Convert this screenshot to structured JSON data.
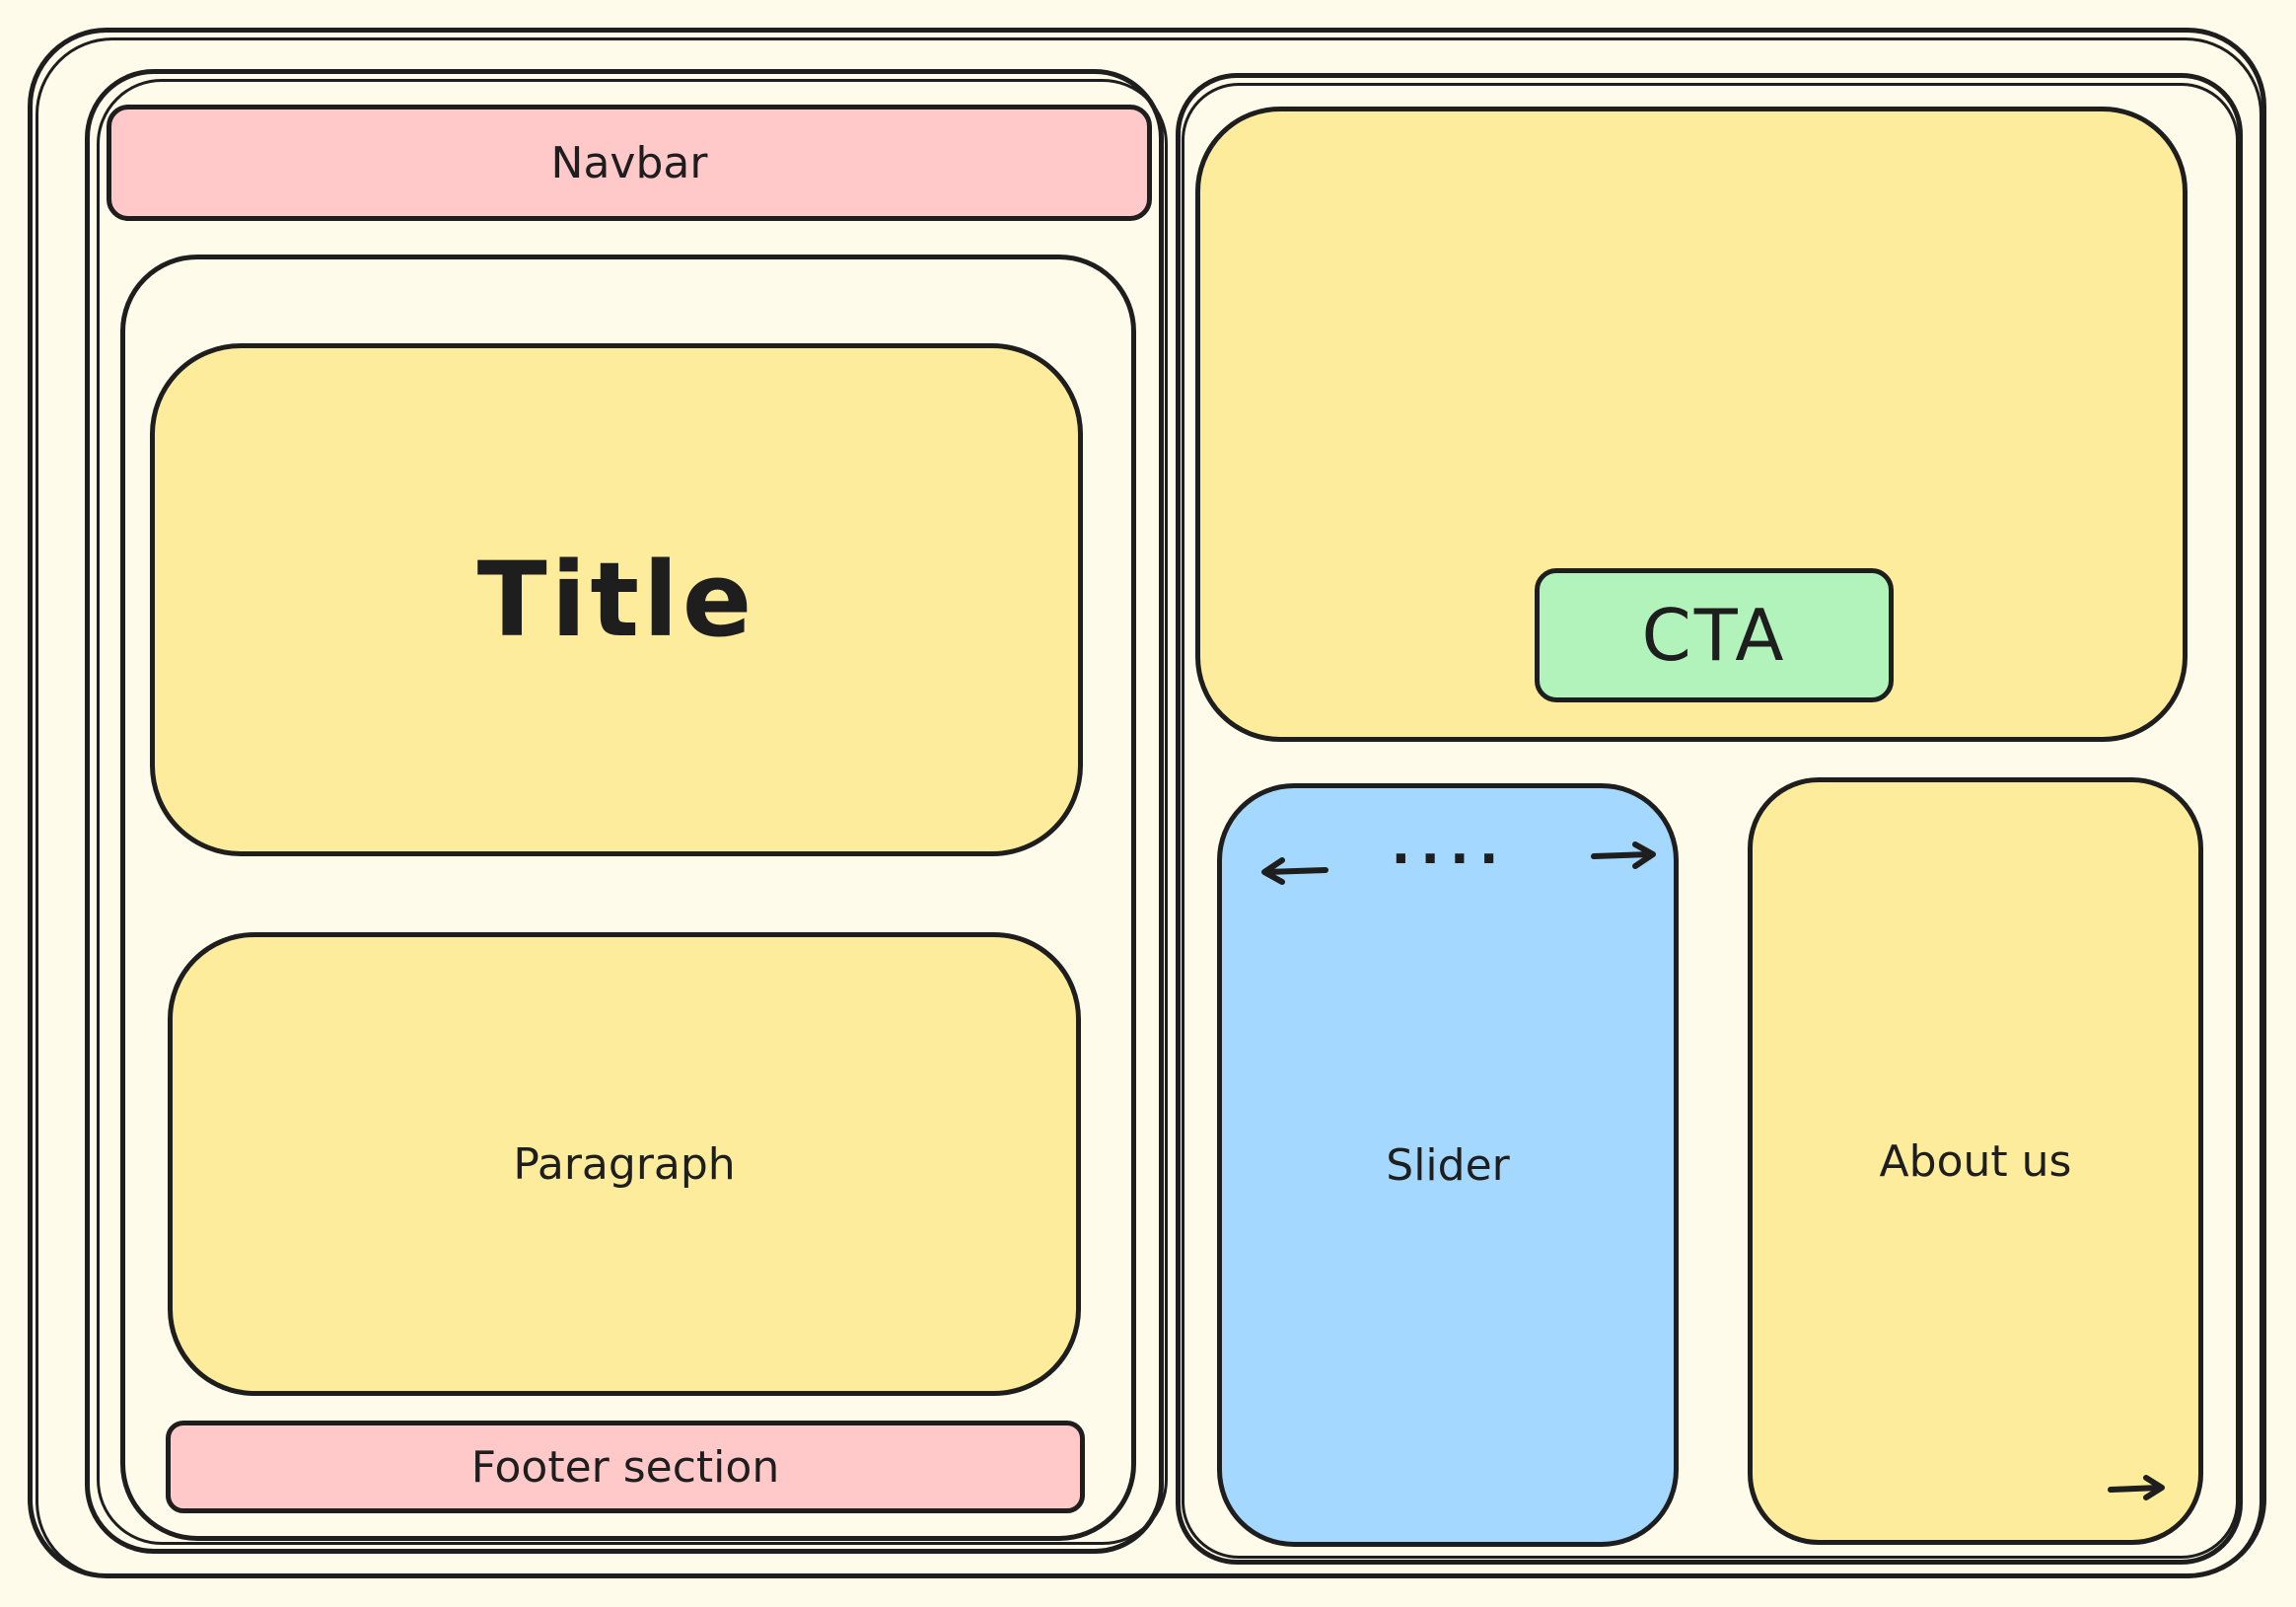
{
  "diagram": {
    "left_column": {
      "navbar": {
        "label": "Navbar"
      },
      "title": {
        "label": "Title"
      },
      "paragraph": {
        "label": "Paragraph"
      },
      "footer": {
        "label": "Footer section"
      }
    },
    "right_column": {
      "hero": {
        "cta": {
          "label": "CTA"
        }
      },
      "slider": {
        "label": "Slider",
        "dots": "...."
      },
      "about": {
        "label": "About us"
      }
    }
  },
  "colors": {
    "background": "#fefbea",
    "stroke": "#1e1e1e",
    "yellow": "#fdec9c",
    "pink": "#ffc8c9",
    "green": "#b2f2bb",
    "blue": "#a5d8ff"
  },
  "icons": [
    "arrow-left-icon",
    "arrow-right-icon",
    "arrow-right-icon"
  ]
}
